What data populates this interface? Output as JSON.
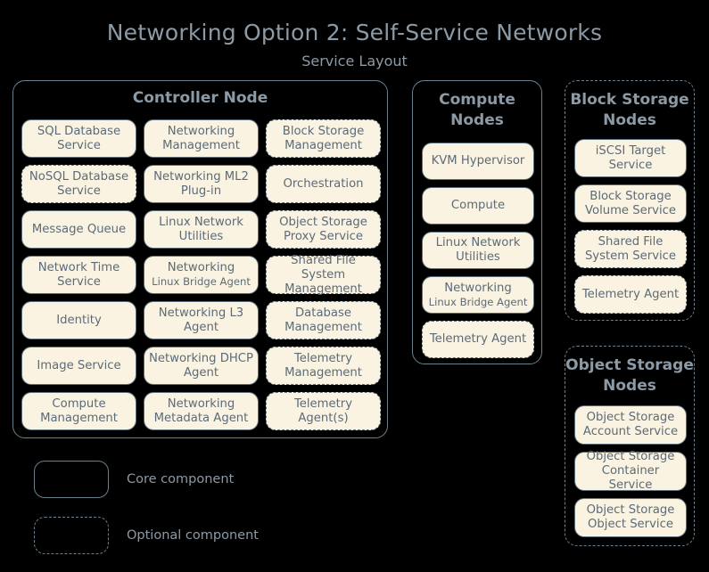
{
  "title": "Networking Option 2: Self-Service Networks",
  "subtitle": "Service Layout",
  "colors": {
    "background": "#000000",
    "container_border": "#6c818f",
    "chip_fill": "#fbf3e2",
    "chip_border": "#5c6f7c",
    "chip_text": "#5b6b78",
    "heading_text": "#8c9aa6"
  },
  "nodes": {
    "controller": {
      "title": "Controller Node",
      "optional": false,
      "components": [
        {
          "label": "SQL Database Service",
          "optional": false
        },
        {
          "label": "Networking Management",
          "optional": false
        },
        {
          "label": "Block Storage Management",
          "optional": true
        },
        {
          "label": "NoSQL Database Service",
          "optional": true
        },
        {
          "label": "Networking ML2 Plug-in",
          "optional": false
        },
        {
          "label": "Orchestration",
          "optional": true
        },
        {
          "label": "Message Queue",
          "optional": false
        },
        {
          "label": "Linux Network Utilities",
          "optional": false
        },
        {
          "label": "Object Storage Proxy Service",
          "optional": true
        },
        {
          "label": "Network Time Service",
          "optional": false
        },
        {
          "label": "Networking",
          "sub": "Linux Bridge Agent",
          "optional": false
        },
        {
          "label": "Shared File System Management",
          "optional": true
        },
        {
          "label": "Identity",
          "optional": false
        },
        {
          "label": "Networking L3 Agent",
          "optional": false
        },
        {
          "label": "Database Management",
          "optional": true
        },
        {
          "label": "Image Service",
          "optional": false
        },
        {
          "label": "Networking DHCP Agent",
          "optional": false
        },
        {
          "label": "Telemetry Management",
          "optional": true
        },
        {
          "label": "Compute Management",
          "optional": false
        },
        {
          "label": "Networking Metadata Agent",
          "optional": false
        },
        {
          "label": "Telemetry Agent(s)",
          "optional": true
        }
      ]
    },
    "compute": {
      "title": "Compute Nodes",
      "optional": false,
      "components": [
        {
          "label": "KVM Hypervisor",
          "optional": false
        },
        {
          "label": "Compute",
          "optional": false
        },
        {
          "label": "Linux Network Utilities",
          "optional": false
        },
        {
          "label": "Networking",
          "sub": "Linux Bridge Agent",
          "optional": false
        },
        {
          "label": "Telemetry Agent",
          "optional": true
        }
      ]
    },
    "block_storage": {
      "title": "Block Storage Nodes",
      "optional": true,
      "components": [
        {
          "label": "iSCSI Target Service",
          "optional": false
        },
        {
          "label": "Block Storage Volume Service",
          "optional": false
        },
        {
          "label": "Shared File System Service",
          "optional": true
        },
        {
          "label": "Telemetry Agent",
          "optional": true
        }
      ]
    },
    "object_storage": {
      "title": "Object Storage Nodes",
      "optional": true,
      "components": [
        {
          "label": "Object Storage Account Service",
          "optional": false
        },
        {
          "label": "Object Storage Container Service",
          "optional": false
        },
        {
          "label": "Object Storage Object Service",
          "optional": false
        }
      ]
    }
  },
  "legend": {
    "core_label": "Core component",
    "optional_label": "Optional component"
  }
}
